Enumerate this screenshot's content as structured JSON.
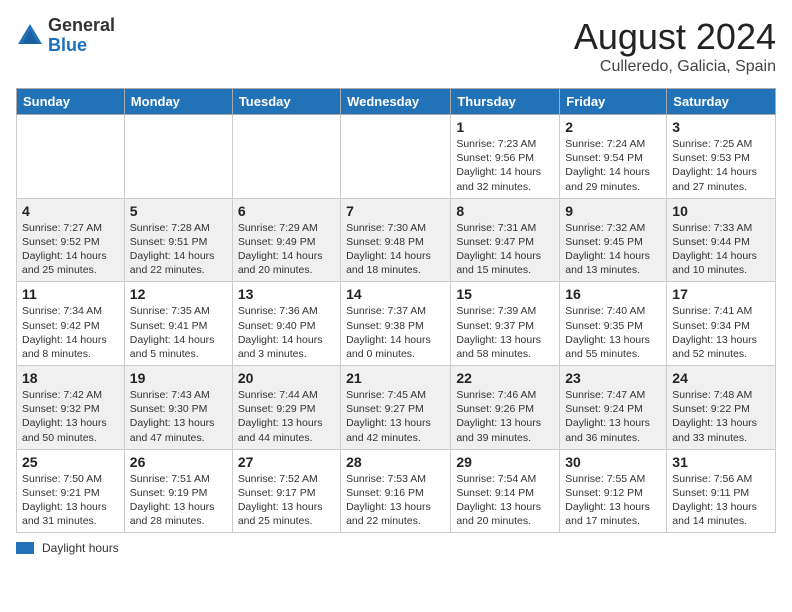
{
  "header": {
    "logo_general": "General",
    "logo_blue": "Blue",
    "month_title": "August 2024",
    "location": "Culleredo, Galicia, Spain"
  },
  "weekdays": [
    "Sunday",
    "Monday",
    "Tuesday",
    "Wednesday",
    "Thursday",
    "Friday",
    "Saturday"
  ],
  "weeks": [
    [
      {
        "day": "",
        "info": ""
      },
      {
        "day": "",
        "info": ""
      },
      {
        "day": "",
        "info": ""
      },
      {
        "day": "",
        "info": ""
      },
      {
        "day": "1",
        "info": "Sunrise: 7:23 AM\nSunset: 9:56 PM\nDaylight: 14 hours and 32 minutes."
      },
      {
        "day": "2",
        "info": "Sunrise: 7:24 AM\nSunset: 9:54 PM\nDaylight: 14 hours and 29 minutes."
      },
      {
        "day": "3",
        "info": "Sunrise: 7:25 AM\nSunset: 9:53 PM\nDaylight: 14 hours and 27 minutes."
      }
    ],
    [
      {
        "day": "4",
        "info": "Sunrise: 7:27 AM\nSunset: 9:52 PM\nDaylight: 14 hours and 25 minutes."
      },
      {
        "day": "5",
        "info": "Sunrise: 7:28 AM\nSunset: 9:51 PM\nDaylight: 14 hours and 22 minutes."
      },
      {
        "day": "6",
        "info": "Sunrise: 7:29 AM\nSunset: 9:49 PM\nDaylight: 14 hours and 20 minutes."
      },
      {
        "day": "7",
        "info": "Sunrise: 7:30 AM\nSunset: 9:48 PM\nDaylight: 14 hours and 18 minutes."
      },
      {
        "day": "8",
        "info": "Sunrise: 7:31 AM\nSunset: 9:47 PM\nDaylight: 14 hours and 15 minutes."
      },
      {
        "day": "9",
        "info": "Sunrise: 7:32 AM\nSunset: 9:45 PM\nDaylight: 14 hours and 13 minutes."
      },
      {
        "day": "10",
        "info": "Sunrise: 7:33 AM\nSunset: 9:44 PM\nDaylight: 14 hours and 10 minutes."
      }
    ],
    [
      {
        "day": "11",
        "info": "Sunrise: 7:34 AM\nSunset: 9:42 PM\nDaylight: 14 hours and 8 minutes."
      },
      {
        "day": "12",
        "info": "Sunrise: 7:35 AM\nSunset: 9:41 PM\nDaylight: 14 hours and 5 minutes."
      },
      {
        "day": "13",
        "info": "Sunrise: 7:36 AM\nSunset: 9:40 PM\nDaylight: 14 hours and 3 minutes."
      },
      {
        "day": "14",
        "info": "Sunrise: 7:37 AM\nSunset: 9:38 PM\nDaylight: 14 hours and 0 minutes."
      },
      {
        "day": "15",
        "info": "Sunrise: 7:39 AM\nSunset: 9:37 PM\nDaylight: 13 hours and 58 minutes."
      },
      {
        "day": "16",
        "info": "Sunrise: 7:40 AM\nSunset: 9:35 PM\nDaylight: 13 hours and 55 minutes."
      },
      {
        "day": "17",
        "info": "Sunrise: 7:41 AM\nSunset: 9:34 PM\nDaylight: 13 hours and 52 minutes."
      }
    ],
    [
      {
        "day": "18",
        "info": "Sunrise: 7:42 AM\nSunset: 9:32 PM\nDaylight: 13 hours and 50 minutes."
      },
      {
        "day": "19",
        "info": "Sunrise: 7:43 AM\nSunset: 9:30 PM\nDaylight: 13 hours and 47 minutes."
      },
      {
        "day": "20",
        "info": "Sunrise: 7:44 AM\nSunset: 9:29 PM\nDaylight: 13 hours and 44 minutes."
      },
      {
        "day": "21",
        "info": "Sunrise: 7:45 AM\nSunset: 9:27 PM\nDaylight: 13 hours and 42 minutes."
      },
      {
        "day": "22",
        "info": "Sunrise: 7:46 AM\nSunset: 9:26 PM\nDaylight: 13 hours and 39 minutes."
      },
      {
        "day": "23",
        "info": "Sunrise: 7:47 AM\nSunset: 9:24 PM\nDaylight: 13 hours and 36 minutes."
      },
      {
        "day": "24",
        "info": "Sunrise: 7:48 AM\nSunset: 9:22 PM\nDaylight: 13 hours and 33 minutes."
      }
    ],
    [
      {
        "day": "25",
        "info": "Sunrise: 7:50 AM\nSunset: 9:21 PM\nDaylight: 13 hours and 31 minutes."
      },
      {
        "day": "26",
        "info": "Sunrise: 7:51 AM\nSunset: 9:19 PM\nDaylight: 13 hours and 28 minutes."
      },
      {
        "day": "27",
        "info": "Sunrise: 7:52 AM\nSunset: 9:17 PM\nDaylight: 13 hours and 25 minutes."
      },
      {
        "day": "28",
        "info": "Sunrise: 7:53 AM\nSunset: 9:16 PM\nDaylight: 13 hours and 22 minutes."
      },
      {
        "day": "29",
        "info": "Sunrise: 7:54 AM\nSunset: 9:14 PM\nDaylight: 13 hours and 20 minutes."
      },
      {
        "day": "30",
        "info": "Sunrise: 7:55 AM\nSunset: 9:12 PM\nDaylight: 13 hours and 17 minutes."
      },
      {
        "day": "31",
        "info": "Sunrise: 7:56 AM\nSunset: 9:11 PM\nDaylight: 13 hours and 14 minutes."
      }
    ]
  ],
  "legend": {
    "label": "Daylight hours"
  }
}
